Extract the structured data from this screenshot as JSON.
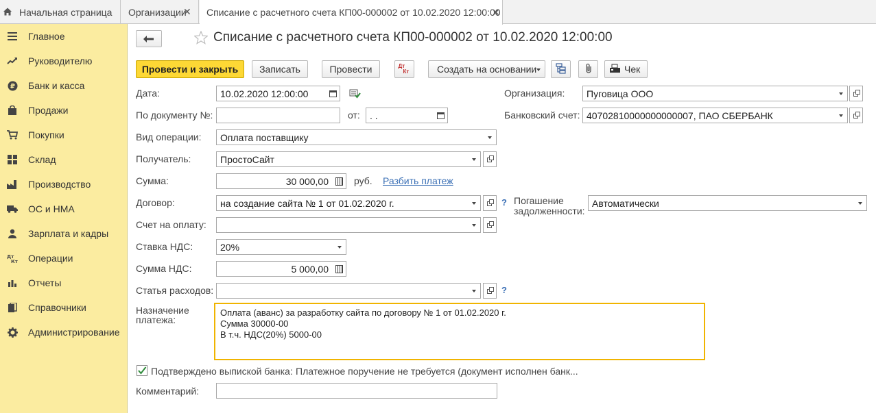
{
  "tabs": {
    "home": "Начальная страница",
    "orgs": "Организации",
    "doc": "Списание с расчетного счета КП00-000002 от 10.02.2020 12:00:00"
  },
  "sidebar": {
    "items": [
      {
        "label": "Главное"
      },
      {
        "label": "Руководителю"
      },
      {
        "label": "Банк и касса"
      },
      {
        "label": "Продажи"
      },
      {
        "label": "Покупки"
      },
      {
        "label": "Склад"
      },
      {
        "label": "Производство"
      },
      {
        "label": "ОС и НМА"
      },
      {
        "label": "Зарплата и кадры"
      },
      {
        "label": "Операции"
      },
      {
        "label": "Отчеты"
      },
      {
        "label": "Справочники"
      },
      {
        "label": "Администрирование"
      }
    ]
  },
  "header": {
    "title": "Списание с расчетного счета КП00-000002 от 10.02.2020 12:00:00"
  },
  "toolbar": {
    "post_close": "Провести и закрыть",
    "save": "Записать",
    "post": "Провести",
    "create_based": "Создать на основании",
    "receipt": "Чек",
    "dt_kt_top": "Дт",
    "dt_kt_bottom": "Кт"
  },
  "form": {
    "date_label": "Дата:",
    "date_value": "10.02.2020 12:00:00",
    "docnum_label": "По документу №:",
    "docnum_value": "",
    "from_label": "от:",
    "from_value": " .  .",
    "optype_label": "Вид операции:",
    "optype_value": "Оплата поставщику",
    "recipient_label": "Получатель:",
    "recipient_value": "ПростоСайт",
    "sum_label": "Сумма:",
    "sum_value": "30 000,00",
    "currency": "руб.",
    "split_link": "Разбить платеж",
    "contract_label": "Договор:",
    "contract_value": "на создание сайта № 1 от 01.02.2020 г.",
    "invoice_label": "Счет на оплату:",
    "invoice_value": "",
    "vat_rate_label": "Ставка НДС:",
    "vat_rate_value": "20%",
    "vat_sum_label": "Сумма НДС:",
    "vat_sum_value": "5 000,00",
    "expense_label": "Статья расходов:",
    "expense_value": "",
    "purpose_label_1": "Назначение",
    "purpose_label_2": "платежа:",
    "purpose_lines": [
      "Оплата (аванс) за разработку сайта по договору № 1 от 01.02.2020 г.",
      "Сумма 30000-00",
      "В т.ч. НДС(20%) 5000-00"
    ],
    "confirmed_label": "Подтверждено выпиской банка:",
    "confirmed_note": "Платежное поручение не требуется (документ исполнен банк...",
    "comment_label": "Комментарий:",
    "comment_value": "",
    "org_label": "Организация:",
    "org_value": "Пуговица ООО",
    "bank_label": "Банковский счет:",
    "bank_value": "40702810000000000007, ПАО СБЕРБАНК",
    "debt_label_1": "Погашение",
    "debt_label_2": "задолженности:",
    "debt_value": "Автоматически",
    "help_mark": "?"
  },
  "colors": {
    "sidebar_bg": "#fbeca0",
    "primary_button": "#fdd835",
    "focus_border": "#f0b400",
    "link": "#3a6fb5",
    "checkbox_check": "#2e8b3a"
  }
}
